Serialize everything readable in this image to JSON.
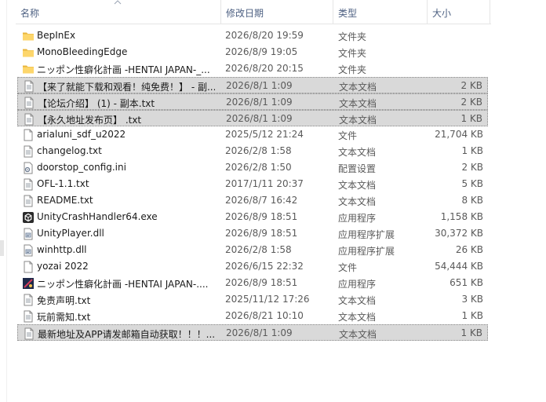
{
  "header": {
    "name": "名称",
    "date": "修改日期",
    "type": "类型",
    "size": "大小"
  },
  "files": [
    {
      "name": "BepInEx",
      "date": "2026/8/20 19:59",
      "type": "文件夹",
      "size": "",
      "icon": "folder-icon",
      "selected": false
    },
    {
      "name": "MonoBleedingEdge",
      "date": "2026/8/9 19:05",
      "type": "文件夹",
      "size": "",
      "icon": "folder-icon",
      "selected": false
    },
    {
      "name": "ニッポン性癖化計画 -HENTAI JAPAN-_...",
      "date": "2026/8/20 20:15",
      "type": "文件夹",
      "size": "",
      "icon": "folder-icon",
      "selected": false
    },
    {
      "name": "【来了就能下载和观看！纯免费！】 - 副...",
      "date": "2026/8/1 1:09",
      "type": "文本文档",
      "size": "2 KB",
      "icon": "text-file-icon",
      "selected": true
    },
    {
      "name": "【论坛介绍】 (1) - 副本.txt",
      "date": "2026/8/1 1:09",
      "type": "文本文档",
      "size": "2 KB",
      "icon": "text-file-icon",
      "selected": true
    },
    {
      "name": "【永久地址发布页】 .txt",
      "date": "2026/8/1 1:09",
      "type": "文本文档",
      "size": "1 KB",
      "icon": "text-file-icon",
      "selected": true
    },
    {
      "name": "arialuni_sdf_u2022",
      "date": "2025/5/12 21:24",
      "type": "文件",
      "size": "21,704 KB",
      "icon": "blank-file-icon",
      "selected": false
    },
    {
      "name": "changelog.txt",
      "date": "2026/2/8 1:58",
      "type": "文本文档",
      "size": "1 KB",
      "icon": "text-file-icon",
      "selected": false
    },
    {
      "name": "doorstop_config.ini",
      "date": "2026/2/8 1:50",
      "type": "配置设置",
      "size": "2 KB",
      "icon": "config-file-icon",
      "selected": false
    },
    {
      "name": "OFL-1.1.txt",
      "date": "2017/1/11 20:37",
      "type": "文本文档",
      "size": "5 KB",
      "icon": "text-file-icon",
      "selected": false
    },
    {
      "name": "README.txt",
      "date": "2026/8/7 16:42",
      "type": "文本文档",
      "size": "8 KB",
      "icon": "text-file-icon",
      "selected": false
    },
    {
      "name": "UnityCrashHandler64.exe",
      "date": "2026/8/9 18:51",
      "type": "应用程序",
      "size": "1,158 KB",
      "icon": "unity-exe-icon",
      "selected": false
    },
    {
      "name": "UnityPlayer.dll",
      "date": "2026/8/9 18:51",
      "type": "应用程序扩展",
      "size": "30,372 KB",
      "icon": "dll-file-icon",
      "selected": false
    },
    {
      "name": "winhttp.dll",
      "date": "2026/2/8 1:58",
      "type": "应用程序扩展",
      "size": "26 KB",
      "icon": "dll-file-icon",
      "selected": false
    },
    {
      "name": "yozai 2022",
      "date": "2026/6/15 22:32",
      "type": "文件",
      "size": "54,444 KB",
      "icon": "blank-file-icon",
      "selected": false
    },
    {
      "name": "ニッポン性癖化計画 -HENTAI JAPAN-....",
      "date": "2026/8/9 18:51",
      "type": "应用程序",
      "size": "651 KB",
      "icon": "game-exe-icon",
      "selected": false
    },
    {
      "name": "免责声明.txt",
      "date": "2025/11/12 17:26",
      "type": "文本文档",
      "size": "3 KB",
      "icon": "text-file-icon",
      "selected": false
    },
    {
      "name": "玩前需知.txt",
      "date": "2026/8/21 10:10",
      "type": "文本文档",
      "size": "1 KB",
      "icon": "text-file-icon",
      "selected": false
    },
    {
      "name": "最新地址及APP请发邮箱自动获取！！！...",
      "date": "2026/8/1 1:09",
      "type": "文本文档",
      "size": "1 KB",
      "icon": "text-file-icon",
      "selected": true
    }
  ]
}
